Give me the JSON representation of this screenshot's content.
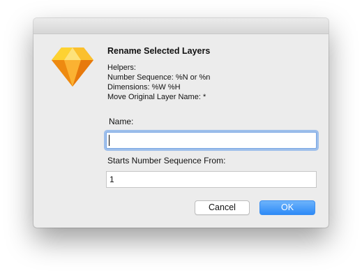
{
  "dialog": {
    "title": "Rename Selected Layers",
    "helpers": [
      "Helpers:",
      "Number Sequence: %N or %n",
      "Dimensions: %W %H",
      "Move Original Layer Name: *"
    ],
    "icon": "sketch-diamond-icon",
    "name_label": "Name:",
    "name_value": "",
    "sequence_label": "Starts Number Sequence From:",
    "sequence_value": "1",
    "cancel_label": "Cancel",
    "ok_label": "OK"
  },
  "colors": {
    "dialog_bg": "#ececec",
    "accent": "#2e8bf7",
    "icon_orange": "#f7a11b",
    "icon_yellow": "#fdd231"
  }
}
